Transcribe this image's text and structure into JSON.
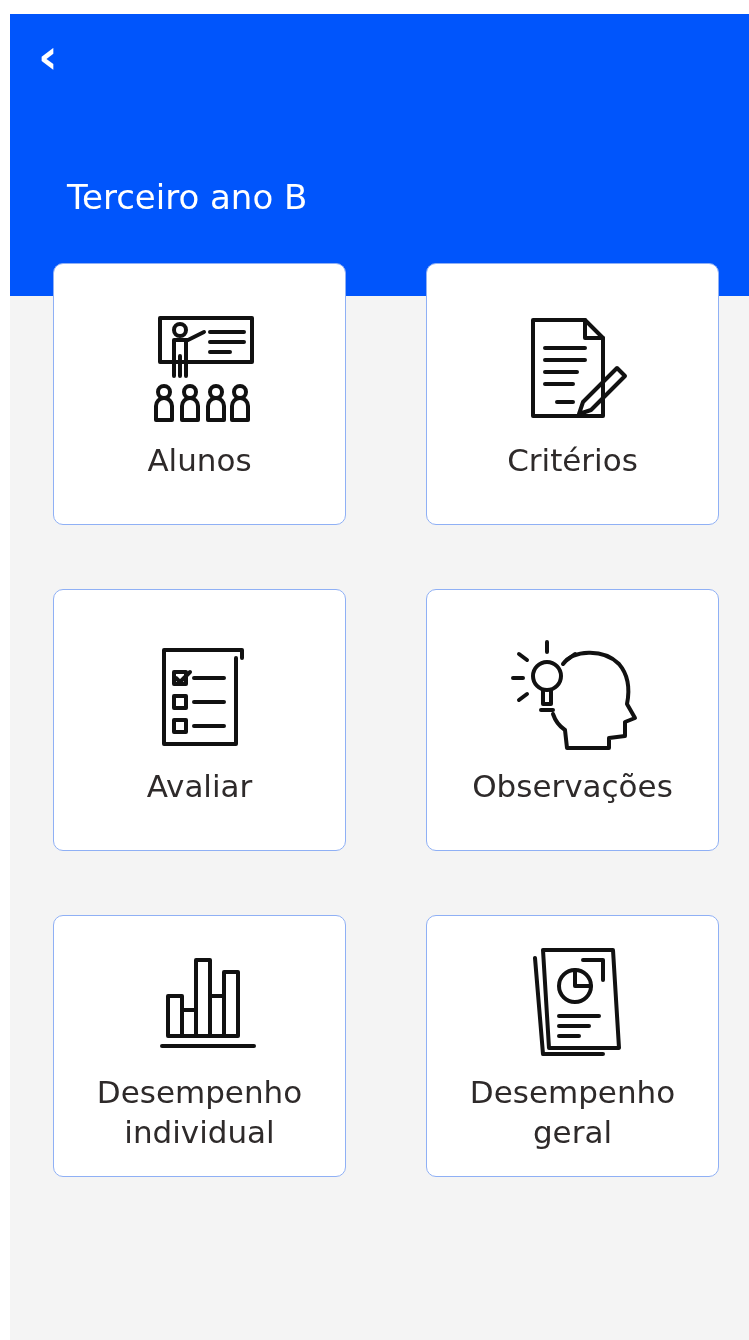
{
  "header": {
    "back": "‹",
    "title": "Terceiro ano B"
  },
  "tiles": [
    {
      "label": "Alunos"
    },
    {
      "label": "Critérios"
    },
    {
      "label": "Avaliar"
    },
    {
      "label": "Observações"
    },
    {
      "label": "Desempenho individual"
    },
    {
      "label": "Desempenho geral"
    }
  ]
}
